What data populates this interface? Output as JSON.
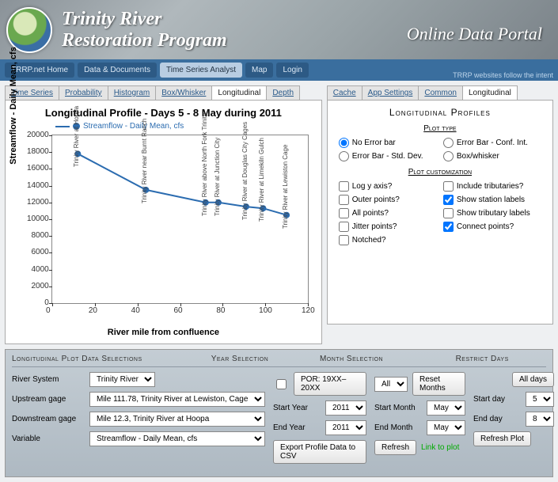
{
  "banner": {
    "title_line1": "Trinity River",
    "title_line2": "Restoration Program",
    "subtitle": "Online Data Portal"
  },
  "topnav": {
    "items": [
      "TRRP.net Home",
      "Data & Documents",
      "Time Series Analyst",
      "Map",
      "Login"
    ],
    "active_index": 2,
    "tagline": "TRRP websites follow the intent"
  },
  "left_tabs": {
    "items": [
      "Time Series",
      "Probability",
      "Histogram",
      "Box/Whisker",
      "Longitudinal",
      "Depth"
    ],
    "active_index": 4
  },
  "right_tabs": {
    "items": [
      "Cache",
      "App Settings",
      "Common",
      "Longitudinal"
    ],
    "active_index": 3
  },
  "chart_data": {
    "type": "line",
    "title": "Longitudinal Profile - Days 5 - 8 May during 2011",
    "legend": "Streamflow - Daily Mean, cfs",
    "xlabel": "River mile from confluence",
    "ylabel": "Streamflow - Daily Mean, cfs",
    "xlim": [
      0,
      120
    ],
    "ylim": [
      0,
      20000
    ],
    "xticks": [
      0,
      20,
      40,
      60,
      80,
      100,
      120
    ],
    "yticks": [
      0,
      2000,
      4000,
      6000,
      8000,
      10000,
      12000,
      14000,
      16000,
      18000,
      20000
    ],
    "points": [
      {
        "x": 12,
        "y": 17800,
        "station": "Trinity River at Hoopa"
      },
      {
        "x": 44,
        "y": 13500,
        "station": "Trinity River near Burnt Ranch"
      },
      {
        "x": 72,
        "y": 12000,
        "station": "Trinity River above North Fork Trinity"
      },
      {
        "x": 78,
        "y": 12000,
        "station": "Trinity River at Junction City"
      },
      {
        "x": 91,
        "y": 11500,
        "station": "Trinity River at Douglas City Cages"
      },
      {
        "x": 99,
        "y": 11300,
        "station": "Trinity River at Limekiln Gulch"
      },
      {
        "x": 110,
        "y": 10500,
        "station": "Trinity River at Lewiston Cage"
      }
    ]
  },
  "right_panel": {
    "heading": "Longitudinal Profiles",
    "plot_type_heading": "Plot type",
    "plot_types": [
      {
        "label": "No Error bar",
        "checked": true
      },
      {
        "label": "Error Bar - Conf. Int.",
        "checked": false
      },
      {
        "label": "Error Bar - Std. Dev.",
        "checked": false
      },
      {
        "label": "Box/whisker",
        "checked": false
      }
    ],
    "custom_heading": "Plot customization",
    "checks_left": [
      {
        "label": "Log y axis?",
        "checked": false
      },
      {
        "label": "Outer points?",
        "checked": false
      },
      {
        "label": "All points?",
        "checked": false
      },
      {
        "label": "Jitter points?",
        "checked": false
      },
      {
        "label": "Notched?",
        "checked": false
      }
    ],
    "checks_right": [
      {
        "label": "Include tributaries?",
        "checked": false
      },
      {
        "label": "Show station labels",
        "checked": true
      },
      {
        "label": "Show tributary labels",
        "checked": false
      },
      {
        "label": "Connect points?",
        "checked": true
      }
    ]
  },
  "bottom": {
    "headers": [
      "Longitudinal Plot Data Selections",
      "Year Selection",
      "Month Selection",
      "Restrict Days"
    ],
    "river_system_label": "River System",
    "river_system_value": "Trinity River",
    "upstream_label": "Upstream gage",
    "upstream_value": "Mile 111.78, Trinity River at Lewiston, Cage",
    "downstream_label": "Downstream gage",
    "downstream_value": "Mile 12.3, Trinity River at Hoopa",
    "variable_label": "Variable",
    "variable_value": "Streamflow - Daily Mean, cfs",
    "por_label": "POR: 19XX–20XX",
    "start_year_label": "Start Year",
    "start_year_value": "2011",
    "end_year_label": "End Year",
    "end_year_value": "2011",
    "export_btn": "Export Profile Data to CSV",
    "all_months_value": "All",
    "reset_months_btn": "Reset Months",
    "start_month_label": "Start Month",
    "start_month_value": "May",
    "end_month_label": "End Month",
    "end_month_value": "May",
    "refresh_btn": "Refresh",
    "link_to_plot": "Link to plot",
    "all_days_btn": "All days",
    "start_day_label": "Start day",
    "start_day_value": "5",
    "end_day_label": "End day",
    "end_day_value": "8",
    "refresh_plot_btn": "Refresh Plot"
  }
}
